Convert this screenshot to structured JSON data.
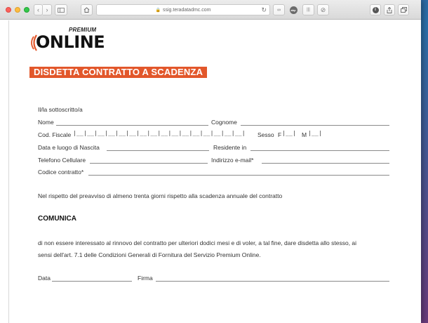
{
  "browser": {
    "url": "ssig.teradatadmc.com",
    "ext_badges": [
      "∞",
      "abp",
      "|||",
      "⊘"
    ]
  },
  "logo": {
    "premium": "PREMIUM",
    "online": "ONLINE"
  },
  "form": {
    "title": "DISDETTA CONTRATTO A SCADENZA",
    "undersigned": "Il/la sottoscritto/a",
    "nome": "Nome",
    "cognome": "Cognome",
    "cod_fiscale": "Cod. Fiscale",
    "cf_boxes": "|__|__|__|__|__|__|__|__|__|__|__|__|__|__|__|__|",
    "sesso": "Sesso",
    "sesso_f": "F",
    "sesso_m": "M",
    "sesso_box": "|__|",
    "nascita": "Data e luogo di Nascita",
    "residente": "Residente in",
    "telefono": "Telefono Cellulare",
    "email": "Indirizzo e-mail*",
    "codice": "Codice contratto*",
    "notice": "Nel rispetto  del preavviso di almeno trenta giorni rispetto  alla scadenza annuale del contratto",
    "comunica": "COMUNICA",
    "body_line1": "di non essere interessato al rinnovo del contratto per ulteriori dodici mesi e di voler, a tal fine, dare disdetta allo stesso, ai",
    "body_line2": "sensi dell'art. 7.1 delle Condizioni Generali di Fornitura del Servizio Premium Online.",
    "data": "Data",
    "firma": "Firma"
  },
  "colors": {
    "banner": "#e2572b",
    "logo_wave": "#e2572b"
  }
}
